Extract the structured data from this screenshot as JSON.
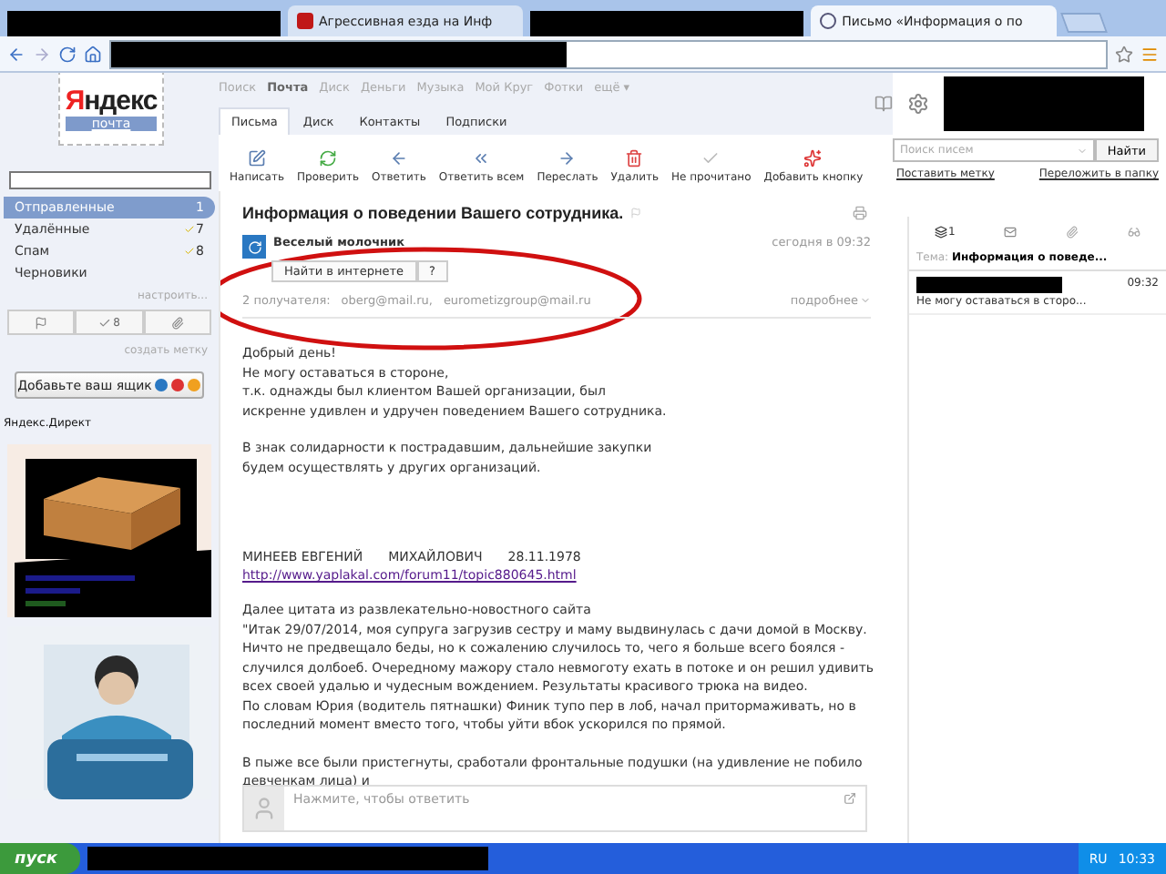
{
  "browser": {
    "tabs": [
      {
        "kind": "redacted",
        "selected": false
      },
      {
        "kind": "tab",
        "title": "Агрессивная езда на Инф",
        "selected": false
      },
      {
        "kind": "redacted",
        "selected": false
      },
      {
        "kind": "tab",
        "title": "Письмо «Информация о по",
        "selected": true
      }
    ]
  },
  "header": {
    "logo": "Яндекс",
    "logo_sub": "почта",
    "services": [
      {
        "label": "Поиск",
        "selected": false
      },
      {
        "label": "Почта",
        "selected": true
      },
      {
        "label": "Диск",
        "selected": false
      },
      {
        "label": "Деньги",
        "selected": false
      },
      {
        "label": "Музыка",
        "selected": false
      },
      {
        "label": "Мой Круг",
        "selected": false
      },
      {
        "label": "Фотки",
        "selected": false
      },
      {
        "label": "ещё ▾",
        "selected": false
      }
    ]
  },
  "mail_tabs": [
    {
      "label": "Письма",
      "selected": true
    },
    {
      "label": "Диск",
      "selected": false
    },
    {
      "label": "Контакты",
      "selected": false
    },
    {
      "label": "Подписки",
      "selected": false
    }
  ],
  "toolbar": [
    "Написать",
    "Проверить",
    "Ответить",
    "Ответить всем",
    "Переслать",
    "Удалить",
    "Не прочитано",
    "Добавить кнопку"
  ],
  "search": {
    "placeholder": "Поиск писем",
    "button": "Найти",
    "links": [
      "Поставить метку",
      "Переложить в папку"
    ]
  },
  "folders": [
    {
      "name": "Отправленные",
      "count": "1",
      "selected": true,
      "checked": false
    },
    {
      "name": "Удалённые",
      "count": "7",
      "selected": false,
      "checked": true
    },
    {
      "name": "Спам",
      "count": "8",
      "selected": false,
      "checked": true
    },
    {
      "name": "Черновики",
      "selected": false,
      "checked": false
    }
  ],
  "setup_link": "настроить...",
  "label_count": "8",
  "create_label": "создать метку",
  "add_box": "Добавьте ваш ящик",
  "direct_title": "Яндекс.Директ",
  "message": {
    "subject": "Информация о поведении Вашего сотрудника.",
    "sender": "Веселый молочник",
    "date": "сегодня в 09:32",
    "find_button": "Найти в интернете",
    "help_button": "?",
    "recipients_label": "2 получателя:",
    "recipients": [
      "oberg@mail.ru,",
      "eurometizgroup@mail.ru"
    ],
    "details": "подробнее",
    "body": [
      {
        "kind": "text",
        "text": "Добрый день!\nНе могу оставаться в стороне,\nт.к. однажды был клиентом Вашей организации, был\nискренне удивлен и удручен поведением Вашего сотрудника."
      },
      {
        "kind": "text",
        "text": "В знак солидарности к пострадавшим, дальнейшие закупки\nбудем осуществлять у других организаций."
      },
      {
        "kind": "signature",
        "parts": [
          "МИНЕЕВ ЕВГЕНИЙ",
          "МИХАЙЛОВИЧ",
          "28.11.1978"
        ]
      },
      {
        "kind": "link",
        "text": "http://www.yaplakal.com/forum11/topic880645.html"
      },
      {
        "kind": "text",
        "text": "Далее цитата из развлекательно-новостного сайта\n\"Итак 29/07/2014, моя супруга загрузив сестру и маму выдвинулась с дачи домой в Москву. Ничто не предвещало беды, но к сожалению случилось то, чего я больше всего боялся - случился долбоеб. Очередному мажору стало невмоготу ехать в потоке и он решил удивить всех своей удалью и чудесным вождением. Результаты красивого трюка на видео.\nПо словам Юрия (водитель пятнашки) Финик тупо пер в лоб, начал притормаживать, но в последний момент вместо того, чтобы уйти вбок ускорился по прямой."
      },
      {
        "kind": "text",
        "text": "В пыже все были пристегнуты, сработали фронтальные подушки (на удивление не побило девченкам лица) и"
      }
    ]
  },
  "reply": {
    "placeholder": "Нажмите, чтобы ответить"
  },
  "thread": {
    "count": "1",
    "subject_label": "Тема:",
    "subject": "Информация о поведе...",
    "items": [
      {
        "time": "09:32",
        "snippet": "Не могу оставаться в сторо..."
      }
    ]
  },
  "taskbar": {
    "start": "пуск",
    "lang": "RU",
    "clock": "10:33"
  }
}
